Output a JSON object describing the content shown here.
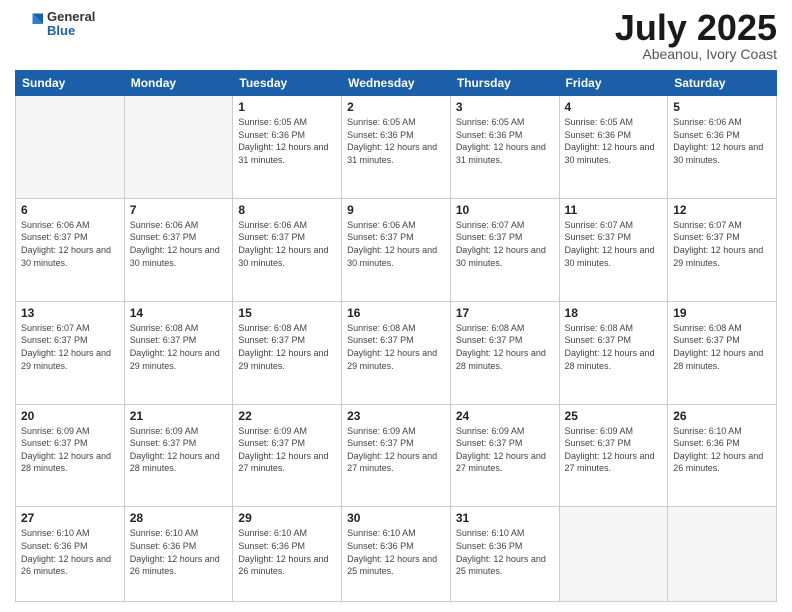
{
  "header": {
    "logo_general": "General",
    "logo_blue": "Blue",
    "month_title": "July 2025",
    "subtitle": "Abeanou, Ivory Coast"
  },
  "days_of_week": [
    "Sunday",
    "Monday",
    "Tuesday",
    "Wednesday",
    "Thursday",
    "Friday",
    "Saturday"
  ],
  "weeks": [
    [
      {
        "day": "",
        "info": ""
      },
      {
        "day": "",
        "info": ""
      },
      {
        "day": "1",
        "info": "Sunrise: 6:05 AM\nSunset: 6:36 PM\nDaylight: 12 hours and 31 minutes."
      },
      {
        "day": "2",
        "info": "Sunrise: 6:05 AM\nSunset: 6:36 PM\nDaylight: 12 hours and 31 minutes."
      },
      {
        "day": "3",
        "info": "Sunrise: 6:05 AM\nSunset: 6:36 PM\nDaylight: 12 hours and 31 minutes."
      },
      {
        "day": "4",
        "info": "Sunrise: 6:05 AM\nSunset: 6:36 PM\nDaylight: 12 hours and 30 minutes."
      },
      {
        "day": "5",
        "info": "Sunrise: 6:06 AM\nSunset: 6:36 PM\nDaylight: 12 hours and 30 minutes."
      }
    ],
    [
      {
        "day": "6",
        "info": "Sunrise: 6:06 AM\nSunset: 6:37 PM\nDaylight: 12 hours and 30 minutes."
      },
      {
        "day": "7",
        "info": "Sunrise: 6:06 AM\nSunset: 6:37 PM\nDaylight: 12 hours and 30 minutes."
      },
      {
        "day": "8",
        "info": "Sunrise: 6:06 AM\nSunset: 6:37 PM\nDaylight: 12 hours and 30 minutes."
      },
      {
        "day": "9",
        "info": "Sunrise: 6:06 AM\nSunset: 6:37 PM\nDaylight: 12 hours and 30 minutes."
      },
      {
        "day": "10",
        "info": "Sunrise: 6:07 AM\nSunset: 6:37 PM\nDaylight: 12 hours and 30 minutes."
      },
      {
        "day": "11",
        "info": "Sunrise: 6:07 AM\nSunset: 6:37 PM\nDaylight: 12 hours and 30 minutes."
      },
      {
        "day": "12",
        "info": "Sunrise: 6:07 AM\nSunset: 6:37 PM\nDaylight: 12 hours and 29 minutes."
      }
    ],
    [
      {
        "day": "13",
        "info": "Sunrise: 6:07 AM\nSunset: 6:37 PM\nDaylight: 12 hours and 29 minutes."
      },
      {
        "day": "14",
        "info": "Sunrise: 6:08 AM\nSunset: 6:37 PM\nDaylight: 12 hours and 29 minutes."
      },
      {
        "day": "15",
        "info": "Sunrise: 6:08 AM\nSunset: 6:37 PM\nDaylight: 12 hours and 29 minutes."
      },
      {
        "day": "16",
        "info": "Sunrise: 6:08 AM\nSunset: 6:37 PM\nDaylight: 12 hours and 29 minutes."
      },
      {
        "day": "17",
        "info": "Sunrise: 6:08 AM\nSunset: 6:37 PM\nDaylight: 12 hours and 28 minutes."
      },
      {
        "day": "18",
        "info": "Sunrise: 6:08 AM\nSunset: 6:37 PM\nDaylight: 12 hours and 28 minutes."
      },
      {
        "day": "19",
        "info": "Sunrise: 6:08 AM\nSunset: 6:37 PM\nDaylight: 12 hours and 28 minutes."
      }
    ],
    [
      {
        "day": "20",
        "info": "Sunrise: 6:09 AM\nSunset: 6:37 PM\nDaylight: 12 hours and 28 minutes."
      },
      {
        "day": "21",
        "info": "Sunrise: 6:09 AM\nSunset: 6:37 PM\nDaylight: 12 hours and 28 minutes."
      },
      {
        "day": "22",
        "info": "Sunrise: 6:09 AM\nSunset: 6:37 PM\nDaylight: 12 hours and 27 minutes."
      },
      {
        "day": "23",
        "info": "Sunrise: 6:09 AM\nSunset: 6:37 PM\nDaylight: 12 hours and 27 minutes."
      },
      {
        "day": "24",
        "info": "Sunrise: 6:09 AM\nSunset: 6:37 PM\nDaylight: 12 hours and 27 minutes."
      },
      {
        "day": "25",
        "info": "Sunrise: 6:09 AM\nSunset: 6:37 PM\nDaylight: 12 hours and 27 minutes."
      },
      {
        "day": "26",
        "info": "Sunrise: 6:10 AM\nSunset: 6:36 PM\nDaylight: 12 hours and 26 minutes."
      }
    ],
    [
      {
        "day": "27",
        "info": "Sunrise: 6:10 AM\nSunset: 6:36 PM\nDaylight: 12 hours and 26 minutes."
      },
      {
        "day": "28",
        "info": "Sunrise: 6:10 AM\nSunset: 6:36 PM\nDaylight: 12 hours and 26 minutes."
      },
      {
        "day": "29",
        "info": "Sunrise: 6:10 AM\nSunset: 6:36 PM\nDaylight: 12 hours and 26 minutes."
      },
      {
        "day": "30",
        "info": "Sunrise: 6:10 AM\nSunset: 6:36 PM\nDaylight: 12 hours and 25 minutes."
      },
      {
        "day": "31",
        "info": "Sunrise: 6:10 AM\nSunset: 6:36 PM\nDaylight: 12 hours and 25 minutes."
      },
      {
        "day": "",
        "info": ""
      },
      {
        "day": "",
        "info": ""
      }
    ]
  ]
}
